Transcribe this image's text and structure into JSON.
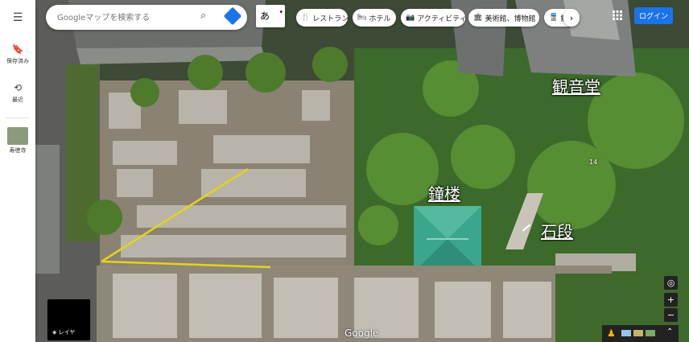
{
  "search": {
    "placeholder": "Googleマップを検索する"
  },
  "ime": {
    "label": "あ"
  },
  "left_rail": {
    "saved": "保存済み",
    "recent": "最近",
    "place": "寿徳寺"
  },
  "chips": [
    {
      "icon": "fork-knife-icon",
      "glyph": "🍴",
      "label": "レストラン"
    },
    {
      "icon": "bed-icon",
      "glyph": "🛏",
      "label": "ホテル"
    },
    {
      "icon": "camera-icon",
      "glyph": "📷",
      "label": "アクティビティ"
    },
    {
      "icon": "museum-icon",
      "glyph": "🏛",
      "label": "美術館、博物館"
    },
    {
      "icon": "train-icon",
      "glyph": "🚆",
      "label": "鉄"
    }
  ],
  "login": "ログイン",
  "labels": {
    "kannondo": "観音堂",
    "shoro": "鐘楼",
    "ishidan": "石段",
    "number": "14"
  },
  "layer_label": "レイヤ",
  "google": "Google",
  "colors": {
    "accent": "#1a73e8",
    "path_line": "#e6d31a",
    "roof": "#3aa68c"
  }
}
